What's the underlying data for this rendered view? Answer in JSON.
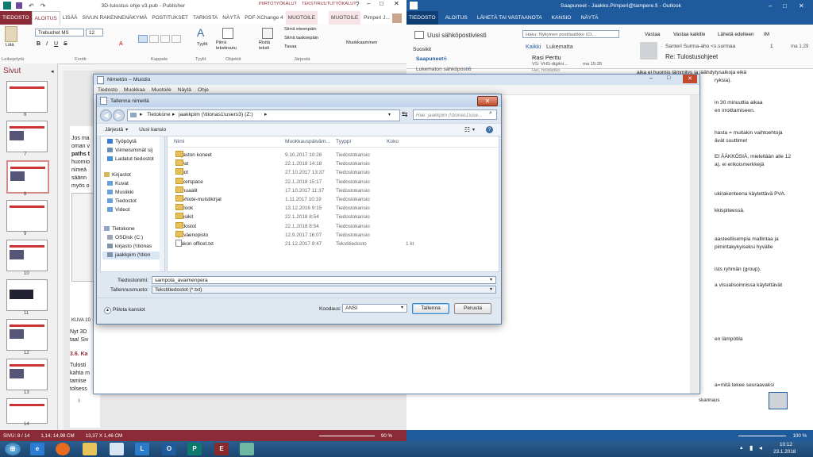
{
  "publisher": {
    "title": "3D-tulostus ohje v3.pub - Publisher",
    "context_tabs": [
      "PIIRTOTYÖKALUT",
      "TEKSTIRUUTUTYÖKALUT"
    ],
    "tabs": [
      "TIEDOSTO",
      "ALOITUS",
      "LISÄÄ",
      "SIVUN RAKENNENÄKYMÄ",
      "POSTITUKSET",
      "TARKISTA",
      "NÄYTÄ",
      "PDF-XChange 4",
      "MUOTOILE",
      "MUOTOILE"
    ],
    "user": "Pimperi J...",
    "font_name": "Trebuchet MS",
    "font_size": "12",
    "ribbon_labels": [
      "Leikepöytä",
      "Fontti",
      "Kappale",
      "Tyylit",
      "Objektit",
      "Järjestä",
      "Muokkaaminen"
    ],
    "ribbon_items": {
      "piirra": "Piirrä tekstiruutu",
      "rivita": "Rivitä teksti",
      "eteen": "Siirrä eteenpäin",
      "taakse": "Siirrä taaksepäin",
      "tasaa": "Tasaa",
      "tyylit": "Tyylit",
      "liita": "Liitä",
      "muokkaaminen": "Muokkaaminen"
    },
    "pages_title": "Sivut",
    "page_numbers": [
      "6",
      "7",
      "8",
      "9",
      "10",
      "11",
      "12",
      "13",
      "14"
    ],
    "doc_text": [
      "Jos ma",
      "oman v",
      "paths t",
      "huomio",
      "nimeä",
      "säänn",
      "myös o",
      "KUVA 10",
      "Nyt 3D",
      "taa! Siv",
      "3.6. Ka",
      "Tulosti",
      "kahta m",
      "tamise",
      "tolsess",
      "8"
    ],
    "status": {
      "page": "SIVU: 8 / 14",
      "position": "1,14; 14,98 CM",
      "size": "13,37 X 1,46 CM",
      "zoom": "90 %"
    }
  },
  "outlook": {
    "title": "Saapuneet - Jaakko.Pimperi@tampere.fi - Outlook",
    "tabs": [
      "TIEDOSTO",
      "ALOITUS",
      "LÄHETÄ TAI VASTAANOTA",
      "KANSIO",
      "NÄYTÄ"
    ],
    "new_mail": "Uusi sähköpostiviesti",
    "search_placeholder": "Haku: Nykyinen postilaatikko (Ct...",
    "filter_all": "Kaikki",
    "filter_unread": "Lukematta",
    "favorites": "Suosikit",
    "inbox": "Saapuneet",
    "inbox_count": "6",
    "unread_folder": "Lukematon sähköposti",
    "unread_count": "6",
    "mail_sender": "Rasi Perttu",
    "mail_subject": "VS: VHS-digitoi...",
    "mail_time": "ma 15:35",
    "mail_preview": "Hei, hoidattko",
    "actions": [
      "Vastaa",
      "Vastaa kaikille",
      "Lähetä edelleen",
      "IM"
    ],
    "reading_sender": "Santeri Surma-aho <s.surmaa",
    "reading_subject": "Re: Tulostusohjeet",
    "reading_count": "1",
    "reading_time": "ma 1.29",
    "reading_lines": [
      "aika ei huomio lämmitys ja jäähdytysaikoja eikä",
      "ryksia).",
      "in 30 minuuttia aikaa",
      "en irroittamiseen.",
      "hasta = muitakin vaihtoehtoja",
      "ävät suuttimet",
      "EI ÄÄKKÖSIÄ, mielellään alle 12",
      "a), ei erikoismerkkejä",
      "ukirakenteena käytettävä PVA.",
      "kkispiteessä.",
      "aasteellisempia mallintaa ja",
      "pimintakykyiseksi hyvälle",
      "ists ryhmän (group).",
      "a visualisoinnissa käytettävät",
      "en lämpötila",
      "a=mitä tekee seuraavaksi"
    ],
    "status_zoom": "100 %",
    "status_sub": "skannaus"
  },
  "notepad": {
    "title": "Nimetön – Muistio",
    "menu": [
      "Tiedosto",
      "Muokkaa",
      "Muotoile",
      "Näytä",
      "Ohje"
    ]
  },
  "dialog": {
    "title": "Tallenna nimellä",
    "breadcrumb": [
      "Tietokone",
      "jaakkpim (\\\\tionas1\\users3) (Z:)"
    ],
    "search_placeholder": "Hae: jaakkpim (\\\\tionas1\\use...",
    "toolbar": {
      "organize": "Järjestä",
      "new_folder": "Uusi kansio"
    },
    "nav": [
      {
        "label": "Työpöytä",
        "type": "desktop"
      },
      {
        "label": "Viimeisimmät sij",
        "type": "recent"
      },
      {
        "label": "Ladatut tiedostot",
        "type": "download"
      },
      {
        "label": "Kirjastot",
        "type": "library"
      },
      {
        "label": "Kuvat",
        "type": "pictures"
      },
      {
        "label": "Musiikki",
        "type": "music"
      },
      {
        "label": "Tiedostot",
        "type": "docs"
      },
      {
        "label": "Videot",
        "type": "videos"
      },
      {
        "label": "Tietokone",
        "type": "computer"
      },
      {
        "label": "OSDisk (C:)",
        "type": "drive"
      },
      {
        "label": "kirjasto (\\\\tionas",
        "type": "netdrive"
      },
      {
        "label": "jaakkpim (\\\\tion",
        "type": "netdrive"
      }
    ],
    "columns": [
      "Nimi",
      "Muokkauspäiväm...",
      "Tyyppi",
      "Koko"
    ],
    "files": [
      {
        "name": "Kirjaston koneet",
        "date": "9.10.2017 10:28",
        "type": "Tiedostokansio",
        "size": "",
        "kind": "folder"
      },
      {
        "name": "Kuvat",
        "date": "22.1.2018 14:18",
        "type": "Tiedostokansio",
        "size": "",
        "kind": "folder"
      },
      {
        "name": "Logot",
        "date": "27.10.2017 13:37",
        "type": "Tiedostokansio",
        "size": "",
        "kind": "folder"
      },
      {
        "name": "Makerspace",
        "date": "22.1.2018 15:17",
        "type": "Tiedostokansio",
        "size": "",
        "kind": "folder"
      },
      {
        "name": "Manuaalit",
        "date": "17.10.2017 11:37",
        "type": "Tiedostokansio",
        "size": "",
        "kind": "folder"
      },
      {
        "name": "OneNote-muistikirjat",
        "date": "1.11.2017 10:19",
        "type": "Tiedostokansio",
        "size": "",
        "kind": "folder"
      },
      {
        "name": "Outlook",
        "date": "13.12.2016 9:15",
        "type": "Tiedostokansio",
        "size": "",
        "kind": "folder"
      },
      {
        "name": "Suosikit",
        "date": "22.1.2018 8:54",
        "type": "Tiedostokansio",
        "size": "",
        "kind": "folder"
      },
      {
        "name": "Tiedostot",
        "date": "22.1.2018 8:54",
        "type": "Tiedostokansio",
        "size": "",
        "kind": "folder"
      },
      {
        "name": "Työväenopisto",
        "date": "12.9.2017 16:07",
        "type": "Tiedostokansio",
        "size": "",
        "kind": "folder"
      },
      {
        "name": "Jaakon officet.txt",
        "date": "21.12.2017 9:47",
        "type": "Tekstitiedosto",
        "size": "1 kt",
        "kind": "txt"
      }
    ],
    "filename_label": "Tiedostonimi:",
    "filename_value": "sampola_avaimenpera",
    "filetype_label": "Tallennusmuoto:",
    "filetype_value": "Tekstitiedostot (*.txt)",
    "hide_folders": "Piilota kansiot",
    "encoding_label": "Koodaus:",
    "encoding_value": "ANSI",
    "save": "Tallenna",
    "cancel": "Peruuta"
  },
  "taskbar": {
    "time": "10:12",
    "date": "23.1.2018"
  }
}
